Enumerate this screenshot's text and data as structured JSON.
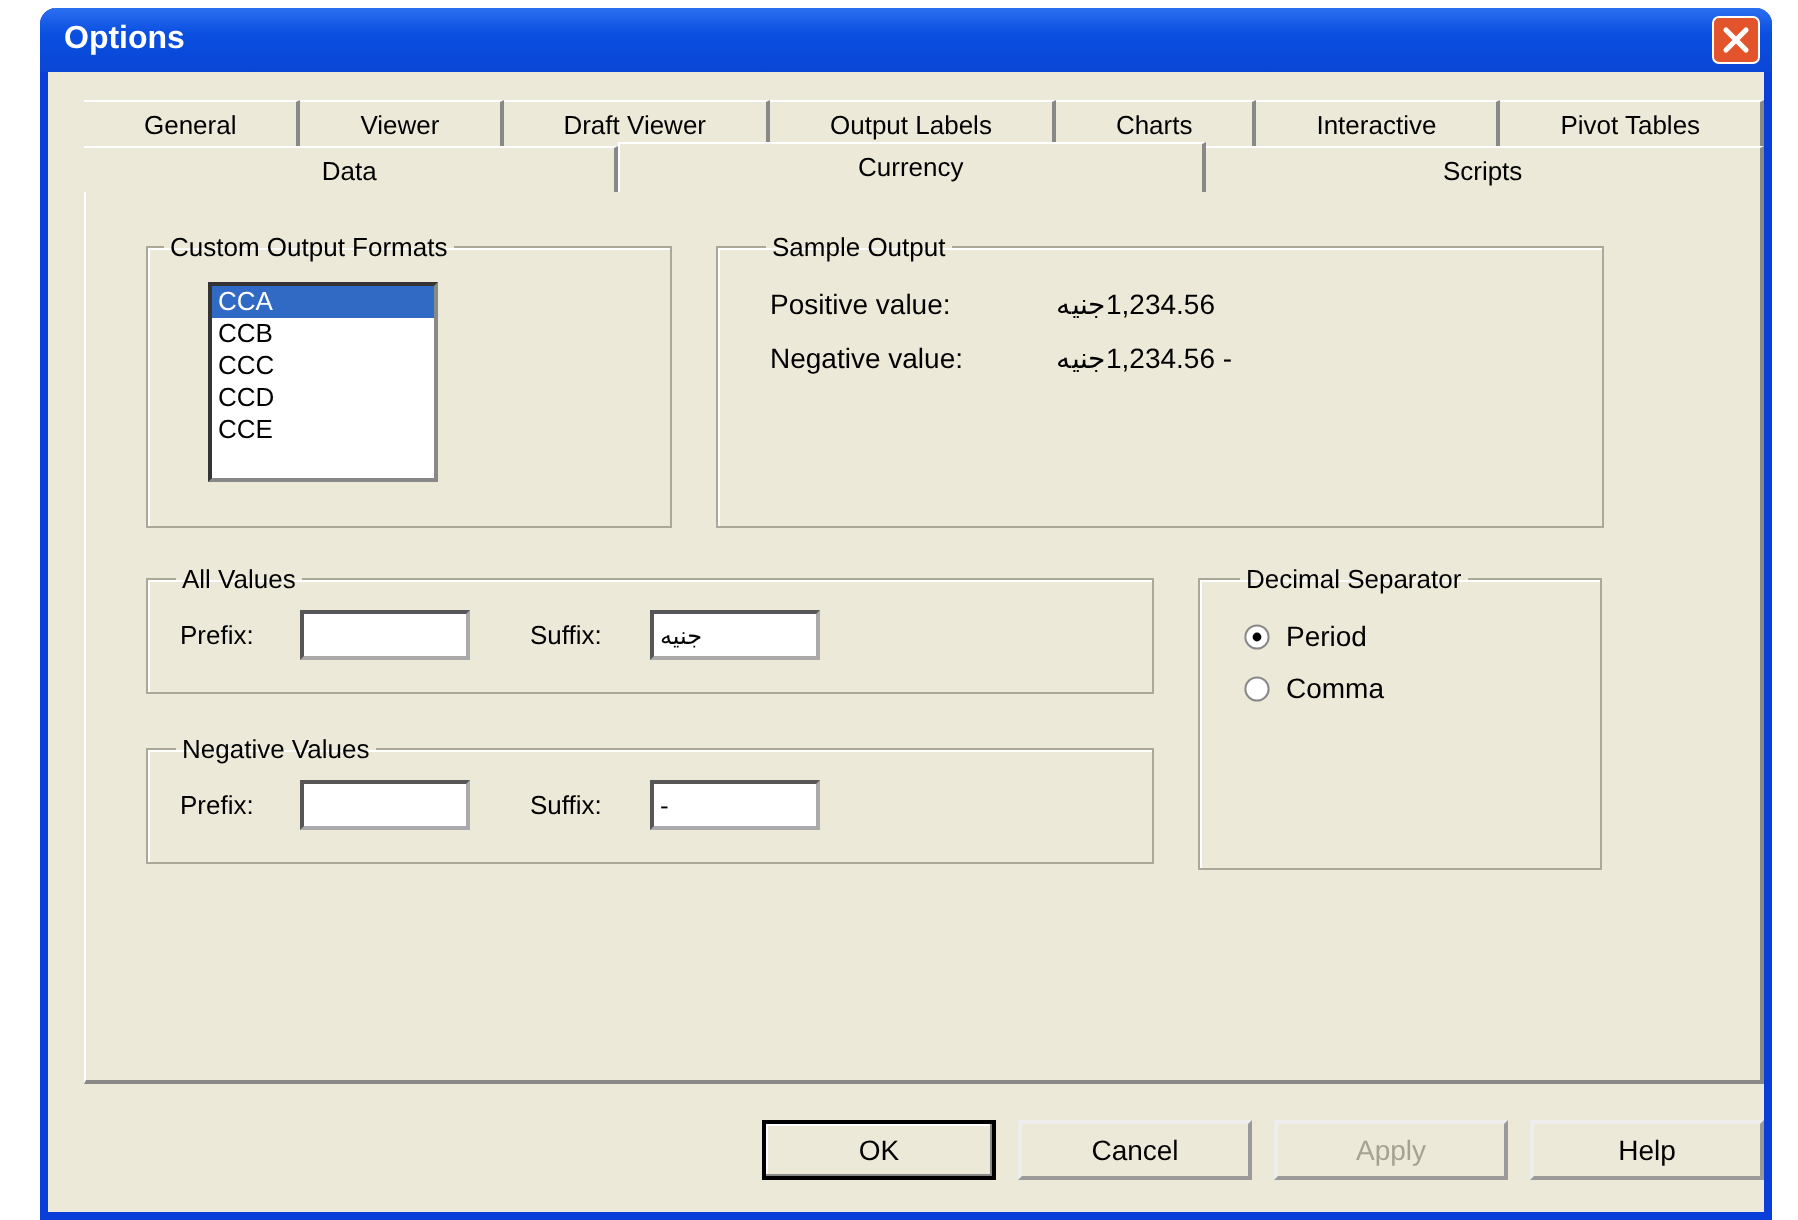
{
  "window": {
    "title": "Options"
  },
  "tab_rows": [
    [
      {
        "label": "General",
        "selected": false
      },
      {
        "label": "Viewer",
        "selected": false
      },
      {
        "label": "Draft Viewer",
        "selected": false
      },
      {
        "label": "Output Labels",
        "selected": false
      },
      {
        "label": "Charts",
        "selected": false
      },
      {
        "label": "Interactive",
        "selected": false
      },
      {
        "label": "Pivot Tables",
        "selected": false
      }
    ],
    [
      {
        "label": "Data",
        "selected": false
      },
      {
        "label": "Currency",
        "selected": true
      },
      {
        "label": "Scripts",
        "selected": false
      }
    ]
  ],
  "custom_output_formats": {
    "title": "Custom Output Formats",
    "items": [
      {
        "label": "CCA",
        "selected": true
      },
      {
        "label": "CCB",
        "selected": false
      },
      {
        "label": "CCC",
        "selected": false
      },
      {
        "label": "CCD",
        "selected": false
      },
      {
        "label": "CCE",
        "selected": false
      }
    ]
  },
  "sample_output": {
    "title": "Sample Output",
    "rows": [
      {
        "label": "Positive value:",
        "value": "1,234.56جنيه"
      },
      {
        "label": "Negative value:",
        "value": "- 1,234.56جنيه"
      }
    ]
  },
  "affix_groups": [
    {
      "title": "All Values",
      "fields": [
        {
          "label": "Prefix:"
        },
        {
          "label": "Suffix:",
          "value": "جنيه"
        }
      ]
    },
    {
      "title": "Negative Values",
      "fields": [
        {
          "label": "Prefix:"
        },
        {
          "label": "Suffix:",
          "value": "-"
        }
      ]
    }
  ],
  "decimal_separator": {
    "title": "Decimal Separator",
    "options": [
      {
        "label": "Period",
        "selected": true
      },
      {
        "label": "Comma",
        "selected": false
      }
    ]
  },
  "buttons": [
    {
      "label": "OK",
      "default": true,
      "disabled": false
    },
    {
      "label": "Cancel",
      "default": false,
      "disabled": false
    },
    {
      "label": "Apply",
      "default": false,
      "disabled": true
    },
    {
      "label": "Help",
      "default": false,
      "disabled": false
    }
  ]
}
